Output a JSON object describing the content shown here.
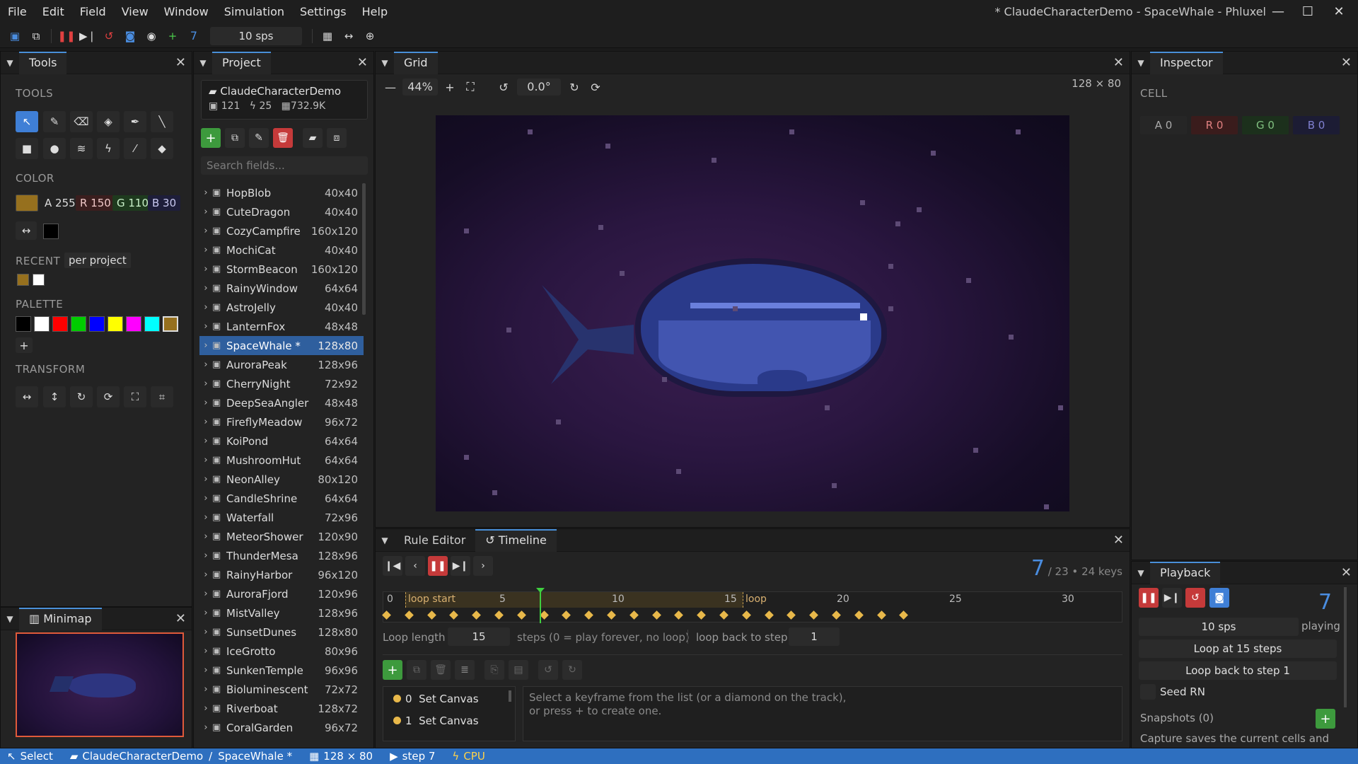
{
  "menu": [
    "File",
    "Edit",
    "Field",
    "View",
    "Window",
    "Simulation",
    "Settings",
    "Help"
  ],
  "window_title": "* ClaudeCharacterDemo - SpaceWhale - Phluxel",
  "toolbar": {
    "step": "7",
    "sps": "10 sps"
  },
  "tools_panel": {
    "title": "Tools",
    "tools_label": "TOOLS",
    "color_label": "COLOR",
    "color": {
      "a": "A 255",
      "r": "R 150",
      "g": "G 110",
      "b": "B 30",
      "hex": "#96701e"
    },
    "recent_label": "RECENT",
    "recent_scope": "per project",
    "palette_label": "PALETTE",
    "palette": [
      "#000000",
      "#ffffff",
      "#ff0000",
      "#00cc00",
      "#0000ff",
      "#ffff00",
      "#ff00ff",
      "#00ffff",
      "#96701e"
    ],
    "transform_label": "TRANSFORM"
  },
  "minimap": {
    "title": "Minimap"
  },
  "project": {
    "title": "Project",
    "name": "ClaudeCharacterDemo",
    "fields_count": "121",
    "rules_count": "25",
    "size": "732.9K",
    "search_placeholder": "Search fields...",
    "fields": [
      {
        "name": "HopBlob",
        "size": "40x40"
      },
      {
        "name": "CuteDragon",
        "size": "40x40"
      },
      {
        "name": "CozyCampfire",
        "size": "160x120"
      },
      {
        "name": "MochiCat",
        "size": "40x40"
      },
      {
        "name": "StormBeacon",
        "size": "160x120"
      },
      {
        "name": "RainyWindow",
        "size": "64x64"
      },
      {
        "name": "AstroJelly",
        "size": "40x40"
      },
      {
        "name": "LanternFox",
        "size": "48x48"
      },
      {
        "name": "SpaceWhale *",
        "size": "128x80"
      },
      {
        "name": "AuroraPeak",
        "size": "128x96"
      },
      {
        "name": "CherryNight",
        "size": "72x92"
      },
      {
        "name": "DeepSeaAngler",
        "size": "48x48"
      },
      {
        "name": "FireflyMeadow",
        "size": "96x72"
      },
      {
        "name": "KoiPond",
        "size": "64x64"
      },
      {
        "name": "MushroomHut",
        "size": "64x64"
      },
      {
        "name": "NeonAlley",
        "size": "80x120"
      },
      {
        "name": "CandleShrine",
        "size": "64x64"
      },
      {
        "name": "Waterfall",
        "size": "72x96"
      },
      {
        "name": "MeteorShower",
        "size": "120x90"
      },
      {
        "name": "ThunderMesa",
        "size": "128x96"
      },
      {
        "name": "RainyHarbor",
        "size": "96x120"
      },
      {
        "name": "AuroraFjord",
        "size": "120x96"
      },
      {
        "name": "MistValley",
        "size": "128x96"
      },
      {
        "name": "SunsetDunes",
        "size": "128x80"
      },
      {
        "name": "IceGrotto",
        "size": "80x96"
      },
      {
        "name": "SunkenTemple",
        "size": "96x96"
      },
      {
        "name": "Bioluminescent",
        "size": "72x72"
      },
      {
        "name": "Riverboat",
        "size": "128x72"
      },
      {
        "name": "CoralGarden",
        "size": "96x72"
      }
    ]
  },
  "grid": {
    "title": "Grid",
    "zoom": "44%",
    "rotation": "0.0°",
    "dimensions": "128 × 80"
  },
  "inspector": {
    "title": "Inspector",
    "cell_label": "CELL",
    "a": "A 0",
    "r": "R 0",
    "g": "G 0",
    "b": "B 0"
  },
  "timeline": {
    "tab_rule": "Rule Editor",
    "tab_timeline": "Timeline",
    "step": "7",
    "total": "/ 23",
    "dot": "•",
    "keys": "24 keys",
    "ticks": [
      "0",
      "5",
      "10",
      "15",
      "20",
      "25",
      "30"
    ],
    "loop_start": "loop start",
    "loop_end": "loop",
    "loop_length_label": "Loop length",
    "loop_length": "15",
    "steps_hint": "steps (0 = play forever, no loop)",
    "loop_back_label": "loop back to step",
    "loop_back": "1",
    "keyframes": [
      {
        "idx": "0",
        "label": "Set Canvas"
      },
      {
        "idx": "1",
        "label": "Set Canvas"
      }
    ],
    "hint_line1": "Select a keyframe from the list (or a diamond on the track),",
    "hint_line2": "or press + to create one."
  },
  "playback": {
    "title": "Playback",
    "step": "7",
    "sps": "10 sps",
    "state": "playing",
    "loop_at": "Loop at 15 steps",
    "loop_back": "Loop back to step 1",
    "seed": "Seed RN",
    "snapshots": "Snapshots (0)",
    "capture_hint": "Capture saves the current cells and"
  },
  "status": {
    "tool": "Select",
    "project": "ClaudeCharacterDemo",
    "sep": "/",
    "field": "SpaceWhale *",
    "dims": "128 × 80",
    "step": "step 7",
    "backend": "CPU"
  }
}
